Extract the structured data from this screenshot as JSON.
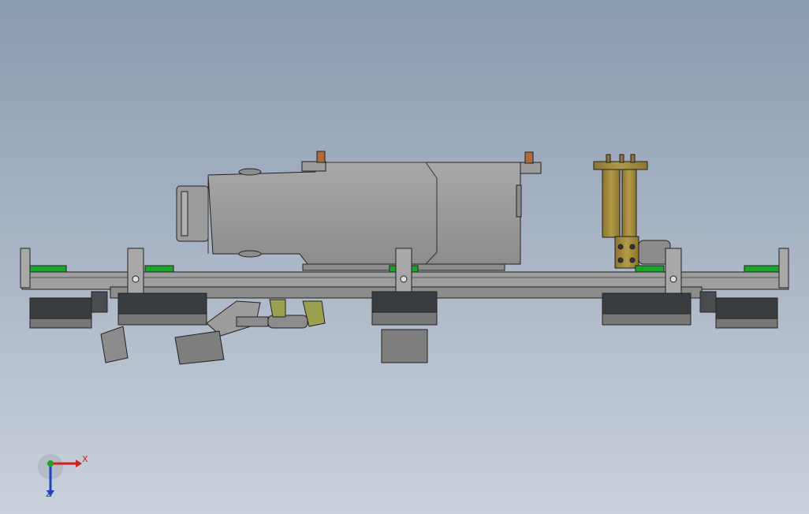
{
  "viewport": {
    "background_top": "#8a9bb0",
    "background_bottom": "#c9d1db"
  },
  "colors": {
    "body_gray": "#9a9a9a",
    "body_gray_dark": "#808080",
    "outline": "#222222",
    "green_pad": "#1aa52a",
    "bronze": "#a08a3c",
    "olive": "#9aa050",
    "copper": "#b06a3a",
    "dark_unit": "#3a3d40",
    "axis_x": "#d02020",
    "axis_y": "#20a020",
    "axis_z": "#2040c0"
  },
  "triad": {
    "x_label": "X",
    "z_label": "Z",
    "x_icon": "axis-x-arrow-icon",
    "y_icon": "axis-y-arrow-icon",
    "z_icon": "axis-z-arrow-icon"
  }
}
